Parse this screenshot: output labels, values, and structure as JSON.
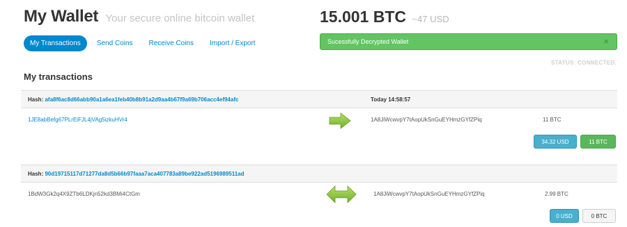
{
  "header": {
    "title": "My Wallet",
    "subtitle": "Your secure online bitcoin wallet"
  },
  "balance": {
    "btc": "15.001 BTC",
    "usd": "~47 USD"
  },
  "nav": {
    "items": [
      {
        "label": "My Transactions",
        "active": true
      },
      {
        "label": "Send Coins",
        "active": false
      },
      {
        "label": "Receive Coins",
        "active": false
      },
      {
        "label": "Import / Export",
        "active": false
      }
    ]
  },
  "alert": {
    "message": "Sucessfully Decrypted Wallet",
    "close": "×"
  },
  "status": "STATUS: CONNECTED.",
  "section_title": "My transactions",
  "transactions": [
    {
      "hash_label": "Hash:",
      "hash": "afa8f6ac8d66abb90a1a6ea1feb40b8b91a2d9aa4b67f9a69b706acc4ef94afc",
      "time": "Today 14:58:57",
      "from": "1JE8abBefg67PLrEiFJL4jVAg5izkuHVr4",
      "direction_icon": "arrow-right-icon",
      "to": "1A8JiWcwvpY7tAopUkSnGuEYHmzGYfZPiq",
      "amount": "11 BTC",
      "usd_button": "34.32 USD",
      "btc_button": "11 BTC"
    },
    {
      "hash_label": "Hash:",
      "hash": "90d19715117d71277da8d5b66b97faaa7aca407783a89be922ad5196989511ad",
      "time": "",
      "from": "1BdW3Gk2q4X9ZTb6LDKjn52kd3BMi4CtGm",
      "direction_icon": "arrow-left-right-icon",
      "to": "1A8JiWcwvpY7tAopUkSnGuEYHmzGYfZPiq",
      "amount": "2.99 BTC",
      "usd_button": "0 USD",
      "btc_button": "0 BTC"
    }
  ],
  "colors": {
    "accent": "#0088cc",
    "alert_green": "#62c462",
    "info": "#49afcd",
    "success": "#5bb75b",
    "arrow_green": "#8dc63f"
  }
}
